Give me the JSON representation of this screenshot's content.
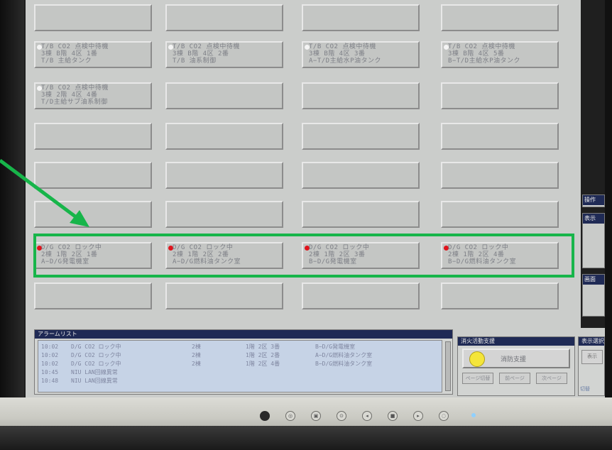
{
  "grid": {
    "rows": [
      [
        "",
        "",
        "",
        ""
      ],
      [
        "T/B CO2 点検中待機\n3棟 B階 4区 1番\nT/B 主給タンク",
        "T/B CO2 点検中待機\n3棟 B階 4区 2番\nT/B 油系制御",
        "T/B CO2 点検中待機\n3棟 B階 4区 3番\nA−T/D主給水P油タンク",
        "T/B CO2 点検中待機\n3棟 B階 4区 5番\nB−T/D主給水P油タンク"
      ],
      [
        "T/B CO2 点検中待機\n3棟 2階 4区 4番\nT/D主給サブ油系制御",
        "",
        "",
        ""
      ],
      [
        "",
        "",
        "",
        ""
      ],
      [
        "",
        "",
        "",
        ""
      ],
      [
        "",
        "",
        "",
        ""
      ],
      [
        "D/G CO2 ロック中\n2棟 1階 2区 1番\nA−D/G発電機室",
        "D/G CO2 ロック中\n2棟 1階 2区 2番\nA−D/G燃料油タンク室",
        "D/G CO2 ロック中\n2棟 1階 2区 3番\nB−D/G発電機室",
        "D/G CO2 ロック中\n2棟 1階 2区 4番\nB−D/G燃料油タンク室"
      ],
      [
        "",
        "",
        "",
        ""
      ]
    ],
    "dots": [
      [
        "",
        "",
        "",
        ""
      ],
      [
        "white",
        "white",
        "white",
        "white"
      ],
      [
        "white",
        "",
        "",
        ""
      ],
      [
        "",
        "",
        "",
        ""
      ],
      [
        "",
        "",
        "",
        ""
      ],
      [
        "",
        "",
        "",
        ""
      ],
      [
        "red",
        "red",
        "red",
        "red"
      ],
      [
        "",
        "",
        "",
        ""
      ]
    ]
  },
  "alarm_list": {
    "title": "アラームリスト",
    "rows": [
      {
        "time": "10:02",
        "tag": "D/G CO2 ロック中",
        "bldg": "2棟",
        "loc": "1階 2区 3番",
        "area": "B−D/G発電機室"
      },
      {
        "time": "10:02",
        "tag": "D/G CO2 ロック中",
        "bldg": "2棟",
        "loc": "1階 2区 2番",
        "area": "A−D/G燃料油タンク室"
      },
      {
        "time": "10:02",
        "tag": "D/G CO2 ロック中",
        "bldg": "2棟",
        "loc": "1階 2区 4番",
        "area": "B−D/G燃料油タンク室"
      },
      {
        "time": "10:45",
        "tag": "NIU LAN回線異常",
        "bldg": "",
        "loc": "",
        "area": ""
      },
      {
        "time": "10:48",
        "tag": "NIU LAN回線異常",
        "bldg": "",
        "loc": "",
        "area": ""
      }
    ]
  },
  "fire_panel": {
    "title": "消火活動支援",
    "main_label": "消防支援",
    "sub_buttons": [
      "ページ切替",
      "前ページ",
      "次ページ"
    ]
  },
  "side_panel": {
    "title_1": "操作",
    "title_2": "表示",
    "title_3": "画面"
  },
  "mini_panel": {
    "title": "表示選択",
    "button": "表示",
    "footer": "切替"
  },
  "colors": {
    "annotation_green": "#17b54a",
    "alarm_red": "#e0141c",
    "title_navy": "#1f2a55"
  }
}
